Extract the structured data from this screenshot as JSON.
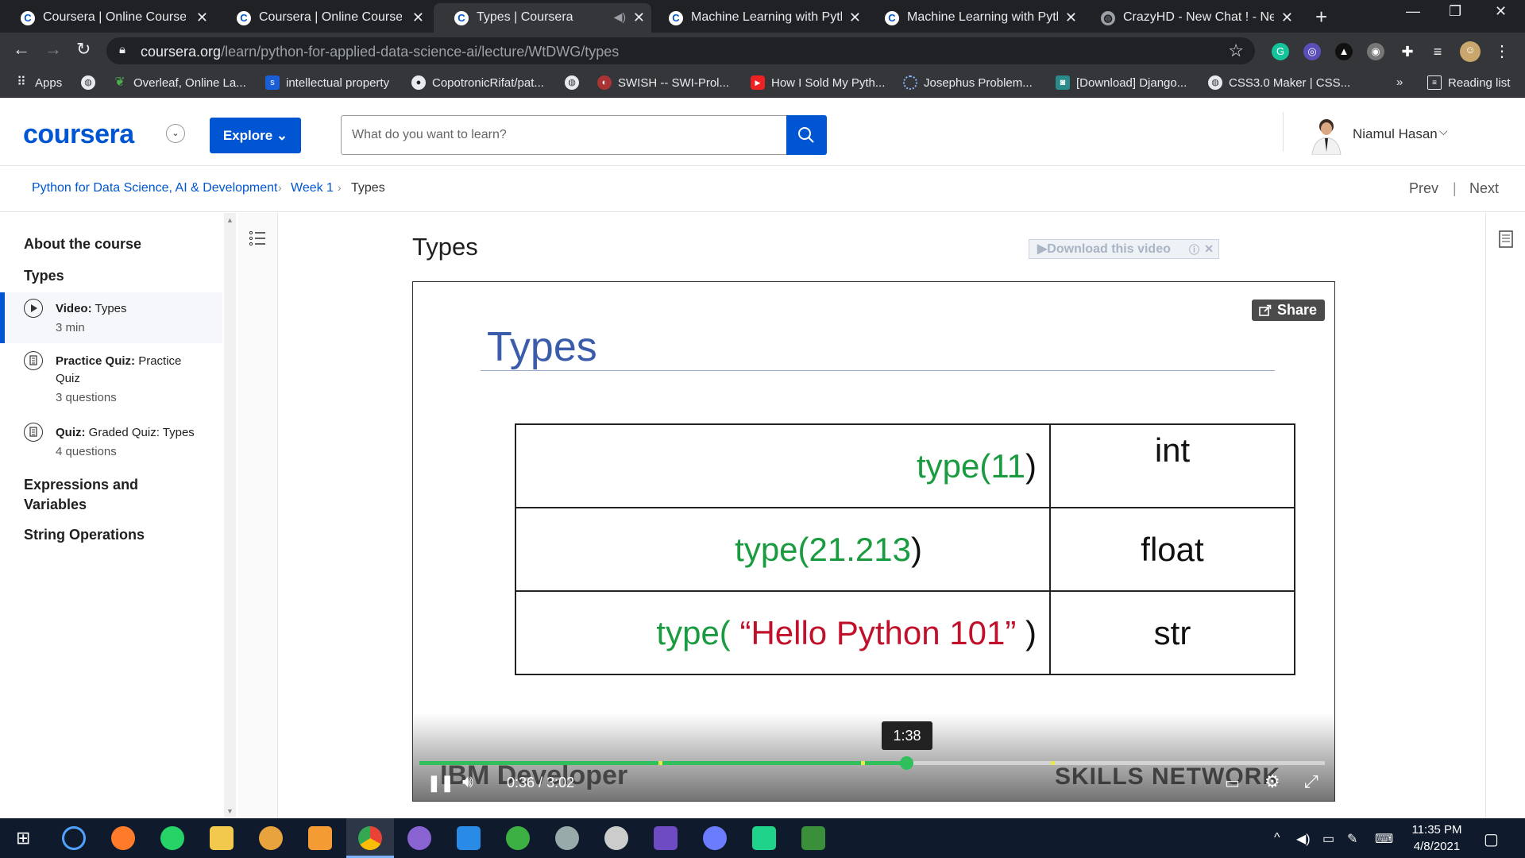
{
  "browser": {
    "tabs": [
      {
        "label": "Coursera | Online Courses &",
        "favicon": "coursera-icon",
        "active": false
      },
      {
        "label": "Coursera | Online Courses &",
        "favicon": "coursera-icon",
        "active": false
      },
      {
        "label": "Types | Coursera",
        "favicon": "coursera-icon",
        "active": true
      },
      {
        "label": "Machine Learning with Pytho",
        "favicon": "coursera-icon",
        "active": false
      },
      {
        "label": "Machine Learning with Pytho",
        "favicon": "coursera-icon",
        "active": false
      },
      {
        "label": "CrazyHD - New Chat ! - New",
        "favicon": "globe-icon",
        "active": false
      }
    ],
    "url_host": "coursera.org",
    "url_path": "/learn/python-for-applied-data-science-ai/lecture/WtDWG/types",
    "bookmarks": [
      {
        "label": "Apps",
        "icon": "apps-grid-icon"
      },
      {
        "label": "",
        "icon": "globe-icon"
      },
      {
        "label": "Overleaf, Online La...",
        "icon": "overleaf-icon"
      },
      {
        "label": "intellectual property",
        "icon": "bookmark-s-icon"
      },
      {
        "label": "CopotronicRifat/pat...",
        "icon": "github-icon"
      },
      {
        "label": "",
        "icon": "globe-icon"
      },
      {
        "label": "SWISH -- SWI-Prol...",
        "icon": "swish-icon"
      },
      {
        "label": "How I Sold My Pyth...",
        "icon": "youtube-icon"
      },
      {
        "label": "Josephus Problem...",
        "icon": "loading-icon"
      },
      {
        "label": "[Download] Django...",
        "icon": "download-site-icon"
      },
      {
        "label": "CSS3.0 Maker | CSS...",
        "icon": "globe-icon"
      }
    ],
    "more_bookmarks": "»",
    "reading_list": "Reading list"
  },
  "header": {
    "logo": "coursera",
    "explore": "Explore",
    "search_placeholder": "What do you want to learn?",
    "username": "Niamul Hasan"
  },
  "breadcrumb": {
    "course": "Python for Data Science, AI & Development",
    "week": "Week 1",
    "current": "Types",
    "prev": "Prev",
    "separator": "|",
    "next": "Next"
  },
  "sidebar": {
    "about": "About the course",
    "section": "Types",
    "items": [
      {
        "kind": "Video:",
        "title": "Types",
        "meta": "3 min",
        "icon": "play-circle-icon",
        "active": true
      },
      {
        "kind": "Practice Quiz:",
        "title": "Practice Quiz",
        "meta": "3 questions",
        "icon": "quiz-icon",
        "active": false
      },
      {
        "kind": "Quiz:",
        "title": "Graded Quiz: Types",
        "meta": "4 questions",
        "icon": "quiz-icon",
        "active": false
      }
    ],
    "sections_after": [
      "Expressions and Variables",
      "String Operations"
    ]
  },
  "lecture": {
    "title": "Types",
    "download_label": "▶Download this video"
  },
  "video": {
    "share": "Share",
    "slide_title": "Types",
    "rows": [
      {
        "code_fn": "type(",
        "code_arg": "11",
        "code_close": ")",
        "arg_color": "green",
        "result": "int"
      },
      {
        "code_fn": "type(",
        "code_arg": "21.213",
        "code_close": ")",
        "arg_color": "green",
        "result": "float"
      },
      {
        "code_fn": "type(",
        "code_arg": " “Hello Python 101” ",
        "code_close": ")",
        "arg_color": "red",
        "result": "str"
      }
    ],
    "hover_time": "1:38",
    "current_time": "0:36",
    "time_separator": "/",
    "duration": "3:02",
    "played_fraction": 0.538,
    "chapter_marks": [
      0.264,
      0.488,
      0.697
    ],
    "brand_left": "IBM Developer",
    "brand_right": "SKILLS NETWORK"
  },
  "taskbar": {
    "time": "11:35 PM",
    "date": "4/8/2021"
  },
  "colors": {
    "coursera_blue": "#0056d2",
    "progress_green": "#2fbf5b",
    "code_green": "#1a9b40",
    "code_red": "#c0102a"
  }
}
